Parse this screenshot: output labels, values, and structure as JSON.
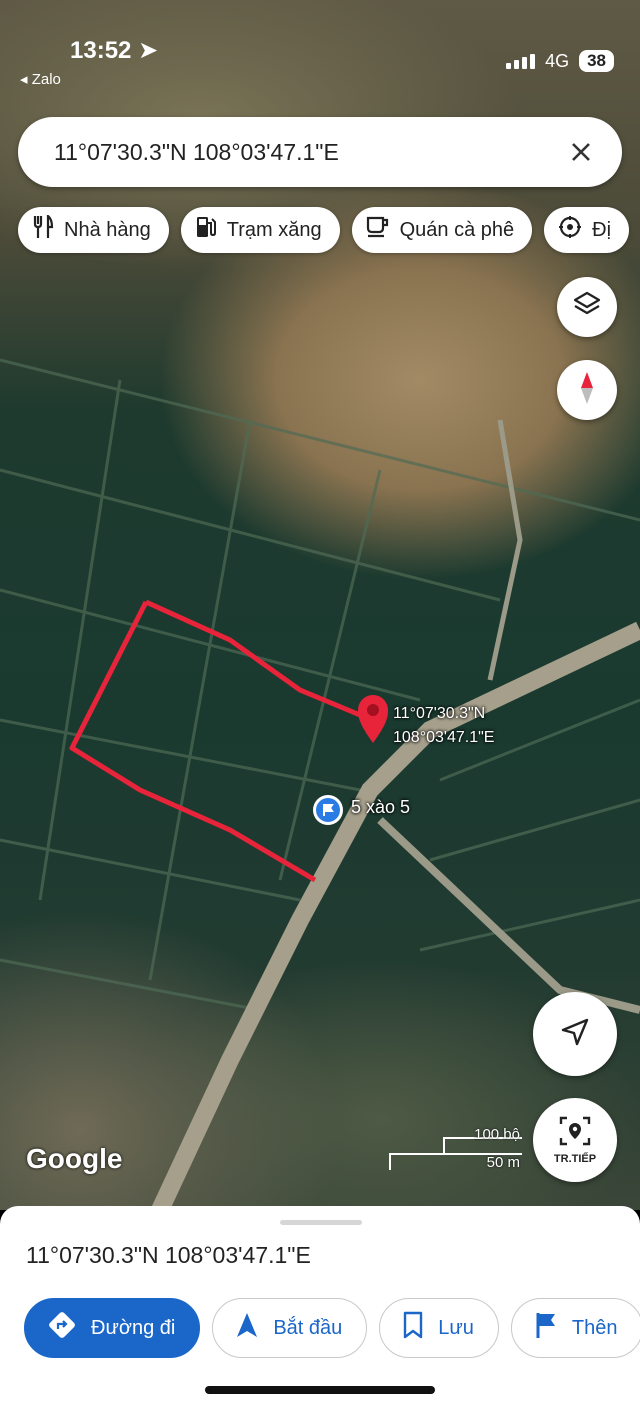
{
  "status_bar": {
    "time": "13:52",
    "back_app": "◂ Zalo",
    "network": "4G",
    "battery": "38"
  },
  "search": {
    "query": "11°07'30.3\"N 108°03'47.1\"E"
  },
  "chips": [
    {
      "label": "Nhà hàng",
      "icon": "restaurant-icon"
    },
    {
      "label": "Trạm xăng",
      "icon": "gas-station-icon"
    },
    {
      "label": "Quán cà phê",
      "icon": "coffee-icon"
    },
    {
      "label": "Đị",
      "icon": "attraction-icon"
    }
  ],
  "map": {
    "pin_label_lat": "11°07'30.3\"N",
    "pin_label_lng": "108°03'47.1\"E",
    "flag_label": "5 xào 5",
    "logo": "Google",
    "scale_top": "100 bộ",
    "scale_bottom": "50 m",
    "live_label": "TR.TIẾP",
    "outline_color": "#e8243a"
  },
  "sheet": {
    "title": "11°07'30.3\"N 108°03'47.1\"E",
    "actions": [
      {
        "label": "Đường đi",
        "icon": "directions-icon"
      },
      {
        "label": "Bắt đầu",
        "icon": "navigation-arrow-icon"
      },
      {
        "label": "Lưu",
        "icon": "bookmark-icon"
      },
      {
        "label": "Thên",
        "icon": "flag-icon"
      }
    ]
  }
}
